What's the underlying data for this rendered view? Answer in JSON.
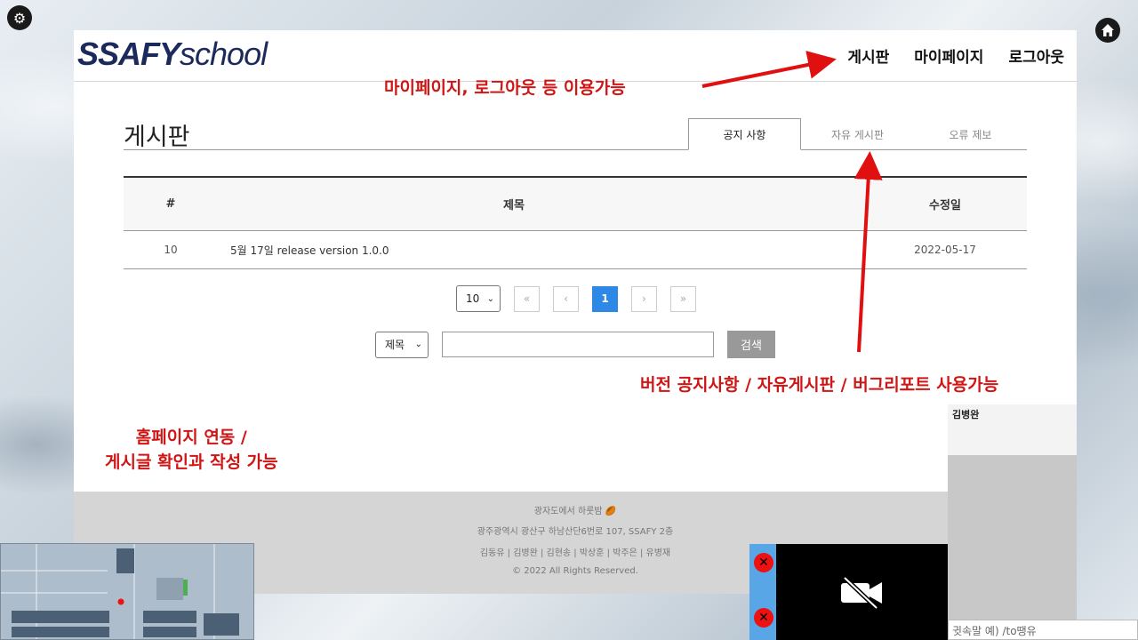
{
  "logo": {
    "part1": "SSAFY",
    "part2": "school"
  },
  "nav": {
    "board": "게시판",
    "mypage": "마이페이지",
    "logout": "로그아웃"
  },
  "board": {
    "title": "게시판",
    "tabs": [
      {
        "label": "공지 사항",
        "active": true
      },
      {
        "label": "자유 게시판",
        "active": false
      },
      {
        "label": "오류 제보",
        "active": false
      }
    ],
    "columns": {
      "num": "#",
      "title": "제목",
      "date": "수정일"
    },
    "rows": [
      {
        "num": "10",
        "title": "5월 17일 release version 1.0.0",
        "date": "2022-05-17"
      }
    ]
  },
  "pager": {
    "page_size": "10",
    "first": "«",
    "prev": "‹",
    "current": "1",
    "next": "›",
    "last": "»"
  },
  "search": {
    "field": "제목",
    "button": "검색"
  },
  "footer": {
    "line1": "광자도에서 하룻밤 🏉",
    "line2": "광주광역시 광산구 하남산단6번로 107, SSAFY 2층",
    "line3": "김동유 | 김병완 | 김현송 | 박상훈 | 박주은 | 유병재",
    "line4": "© 2022 All Rights Reserved."
  },
  "annotations": {
    "top": "마이페이지, 로그아웃 등 이용가능",
    "right": "버전 공지사항 / 자유게시판 / 버그리포트 사용가능",
    "left_line1": "홈페이지 연동 /",
    "left_line2": "게시글 확인과 작성 가능"
  },
  "chat": {
    "user": "김병완",
    "input_placeholder": "귓속말 예) /to땡유"
  },
  "icons": {
    "settings": "gear-icon",
    "home": "home-icon",
    "camera_off": "camera-off-icon"
  },
  "colors": {
    "accent": "#d01515",
    "page_current": "#2d89e5",
    "logo": "#1b2a5b"
  }
}
